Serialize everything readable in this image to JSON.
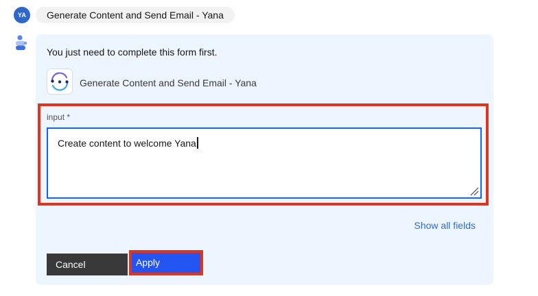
{
  "user": {
    "initials": "YA",
    "message": "Generate Content and Send Email - Yana"
  },
  "assistant": {
    "intro": "You just need to complete this form first.",
    "app_name": "Generate Content and Send Email - Yana",
    "app_icon": "sync-circle-icon"
  },
  "form": {
    "input_label": "input *",
    "input_value": "Create content to welcome Yana",
    "show_all_fields": "Show all fields",
    "cancel_label": "Cancel",
    "apply_label": "Apply"
  },
  "colors": {
    "primary": "#0f62fe",
    "link": "#2d6bdc",
    "highlight": "#e0341f",
    "card_bg": "#edf5ff",
    "cancel_bg": "#393939",
    "apply_bg": "#2454f2"
  }
}
